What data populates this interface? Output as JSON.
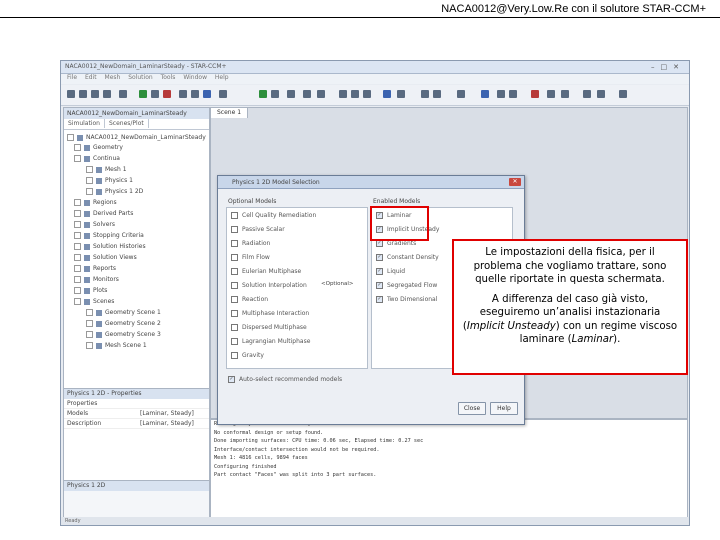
{
  "slide": {
    "title": "NACA0012@Very.Low.Re con il solutore STAR-CCM+"
  },
  "app": {
    "window_title": "NACA0012_NewDomain_LaminarSteady - STAR-CCM+",
    "menu": [
      "File",
      "Edit",
      "Mesh",
      "Solution",
      "Tools",
      "Window",
      "Help"
    ],
    "graphics_tab": "Scene 1",
    "statusbar": "Ready"
  },
  "tree_panel": {
    "title": "NACA0012_NewDomain_LaminarSteady",
    "tabs": [
      "Simulation",
      "Scenes/Plot"
    ],
    "root": "NACA0012_NewDomain_LaminarSteady",
    "items": [
      "Geometry",
      "Continua",
      "Mesh 1",
      "Physics 1",
      "Physics 1 2D",
      "Regions",
      "Derived Parts",
      "Solvers",
      "Stopping Criteria",
      "Solution Histories",
      "Solution Views",
      "Reports",
      "Monitors",
      "Plots",
      "Scenes",
      "Geometry Scene 1",
      "Geometry Scene 2",
      "Geometry Scene 3",
      "Mesh Scene 1"
    ]
  },
  "properties_panel": {
    "title": "Physics 1 2D - Properties",
    "section": "Properties",
    "rows": [
      {
        "label": "Models",
        "value": "[Laminar, Steady]"
      },
      {
        "label": "Description",
        "value": "[Laminar, Steady]"
      }
    ],
    "footer_title": "Physics 1 2D"
  },
  "output_log": [
    "Reading \"Physics 1 2D\" and \"Physics 1\" from mesh file...",
    "No conformal design or setup found.",
    "Done importing surfaces: CPU time: 0.06 sec, Elapsed time: 0.27 sec",
    "Interface/contact intersection would not be required.",
    "Mesh 1: 4816 cells, 9894 faces",
    "Configuring finished",
    "Part contact \"Faces\" was split into 3 part surfaces."
  ],
  "dialog": {
    "title": "Physics 1 2D Model Selection",
    "optional_label": "Optional Models",
    "enabled_label": "Enabled Models",
    "optional_models": [
      "Cell Quality Remediation",
      "Passive Scalar",
      "Radiation",
      "Film Flow",
      "Eulerian Multiphase",
      "Solution Interpolation",
      "Reaction",
      "Multiphase Interaction",
      "Dispersed Multiphase",
      "Lagrangian Multiphase",
      "Gravity"
    ],
    "optional_marker": "<Optional>",
    "enabled_models": [
      "Laminar",
      "Implicit Unsteady",
      "Gradients",
      "Constant Density",
      "Liquid",
      "Segregated Flow",
      "Two Dimensional"
    ],
    "footer_checkbox": "Auto-select recommended models",
    "close_button": "Close",
    "help_button": "Help"
  },
  "callout": {
    "p1": "Le impostazioni della fisica, per il problema che vogliamo trattare, sono quelle riportate in questa schermata.",
    "p2_a": "A differenza del caso già visto, eseguiremo un’analisi instazionaria (",
    "p2_em1": "Implicit Unsteady",
    "p2_b": ") con un regime viscoso laminare (",
    "p2_em2": "Laminar",
    "p2_c": ")."
  }
}
